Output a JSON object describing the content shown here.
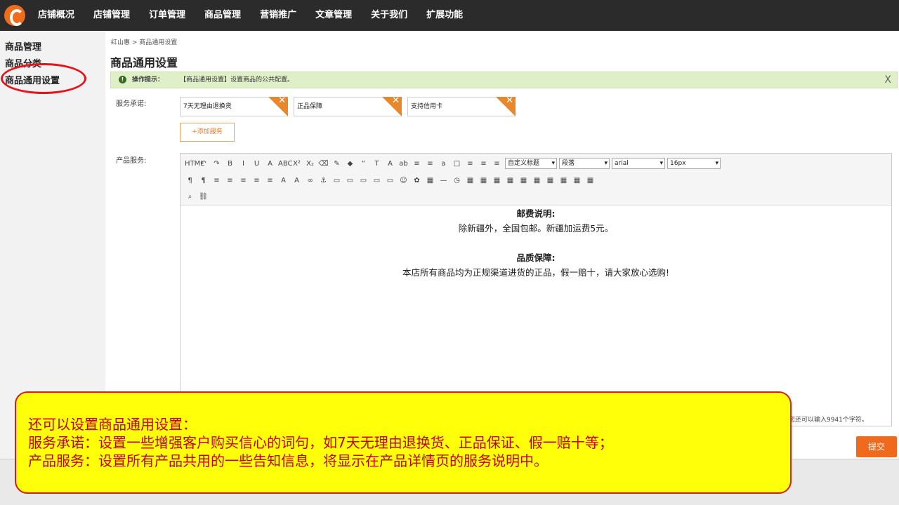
{
  "nav": {
    "items": [
      "店铺概况",
      "店铺管理",
      "订单管理",
      "商品管理",
      "营销推广",
      "文章管理",
      "关于我们",
      "扩展功能"
    ]
  },
  "sidebar": {
    "items": [
      "商品管理",
      "商品分类",
      "商品通用设置"
    ]
  },
  "breadcrumb": "红山惠 > 商品通用设置",
  "page_title": "商品通用设置",
  "tip": {
    "icon": "!",
    "title": "操作提示：",
    "text": "【商品通用设置】设置商品的公共配置。",
    "close": "X"
  },
  "service": {
    "label": "服务承诺:",
    "tags": [
      "7天无理由退换货",
      "正品保障",
      "支持信用卡"
    ],
    "remove_glyph": "✕",
    "add_label": "+添加服务"
  },
  "product_service": {
    "label": "产品服务:"
  },
  "editor": {
    "toolbar_row1": [
      "HTML",
      "↶",
      "↷",
      "B",
      "I",
      "U",
      "A",
      "ABC",
      "X²",
      "X₂",
      "⌫",
      "✎",
      "◆",
      "“",
      "T",
      "A",
      "ab",
      "≡",
      "≡",
      "a",
      "□",
      "≡",
      "≡",
      "≡"
    ],
    "heading_select": "自定义标题",
    "paragraph_select": "段落",
    "font_select": "arial",
    "size_select": "16px",
    "toolbar_row2": [
      "¶",
      "¶",
      "≡",
      "≡",
      "≡",
      "≡",
      "≡",
      "A",
      "A",
      "∞",
      "⚓",
      "▭",
      "▭",
      "▭",
      "▭",
      "▭",
      "☺",
      "✿",
      "▦",
      "—",
      "◷",
      "▦",
      "▦",
      "▦",
      "▦",
      "▦",
      "▦",
      "▦",
      "▦",
      "▦",
      "▦"
    ],
    "toolbar_row3": [
      "⌕",
      "⛓"
    ],
    "content": [
      {
        "text": "邮费说明:",
        "bold": true
      },
      {
        "text": "除新疆外，全国包邮。新疆加运费5元。",
        "bold": false
      },
      {
        "text": "",
        "bold": false
      },
      {
        "text": "品质保障:",
        "bold": true
      },
      {
        "text": "本店所有商品均为正规渠道进货的正品，假一赔十，请大家放心选购!",
        "bold": false
      }
    ],
    "counter": "您还可以输入9941个字符。"
  },
  "submit_label": "提交",
  "callout": {
    "lines": [
      "还可以设置商品通用设置：",
      "服务承诺：设置一些增强客户购买信心的词句，如7天无理由退换货、正品保证、假一赔十等；",
      "产品服务：设置所有产品共用的一些告知信息，将显示在产品详情页的服务说明中。"
    ]
  },
  "colors": {
    "topbar": "#2b2b2b",
    "accent": "#f06a1e",
    "callout_bg": "#ffff0a",
    "callout_text": "#c3001c",
    "highlight_ring": "#e8131b"
  }
}
